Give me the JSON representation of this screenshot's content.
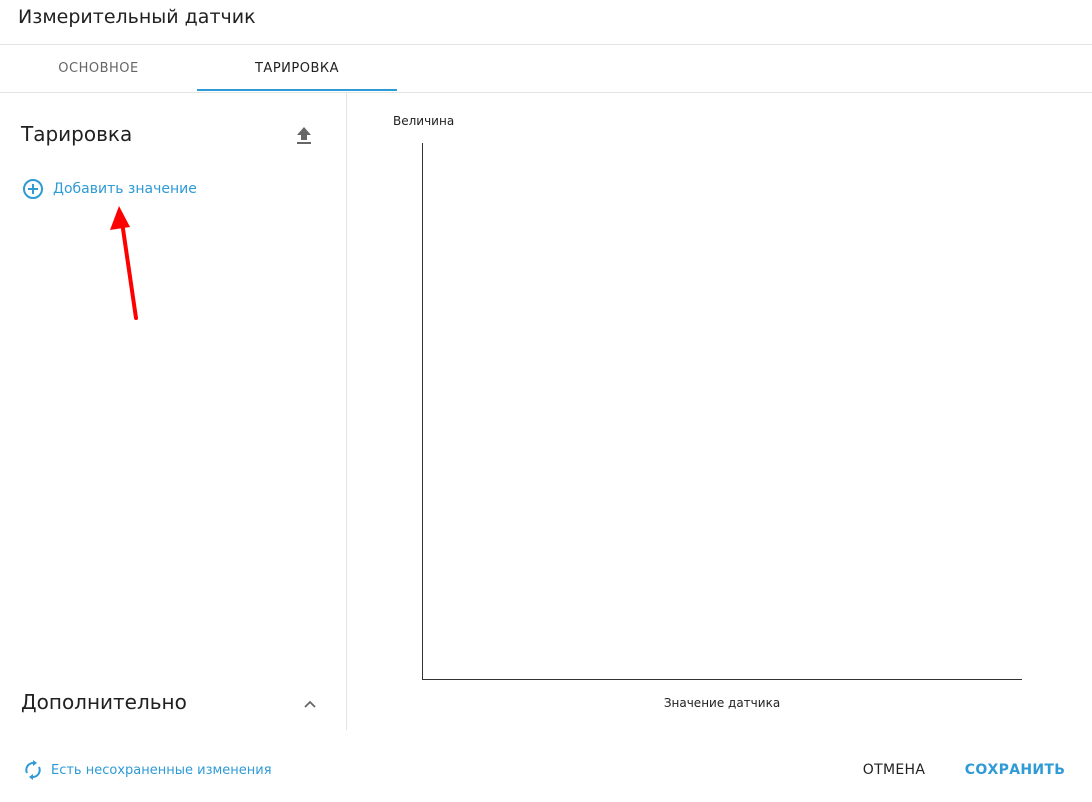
{
  "dialog": {
    "title": "Измерительный датчик"
  },
  "tabs": [
    {
      "label": "ОСНОВНОЕ",
      "active": false
    },
    {
      "label": "ТАРИРОВКА",
      "active": true
    }
  ],
  "tare_panel": {
    "title": "Тарировка",
    "upload_icon": "upload-icon",
    "add_value_label": "Добавить значение",
    "add_value_icon": "add-circle-icon"
  },
  "additional": {
    "title": "Дополнительно",
    "toggle_icon": "chevron-up-icon"
  },
  "chart_data": {
    "type": "line",
    "ylabel": "Величина",
    "xlabel": "Значение датчика",
    "series": [],
    "grid": false
  },
  "footer": {
    "status_label": "Есть несохраненные изменения",
    "status_icon": "sync-icon",
    "cancel_label": "ОТМЕНА",
    "save_label": "СОХРАНИТЬ"
  },
  "colors": {
    "accent": "#2e9ad6",
    "annotation_arrow": "#ff0000",
    "divider": "#e4e4e4"
  }
}
